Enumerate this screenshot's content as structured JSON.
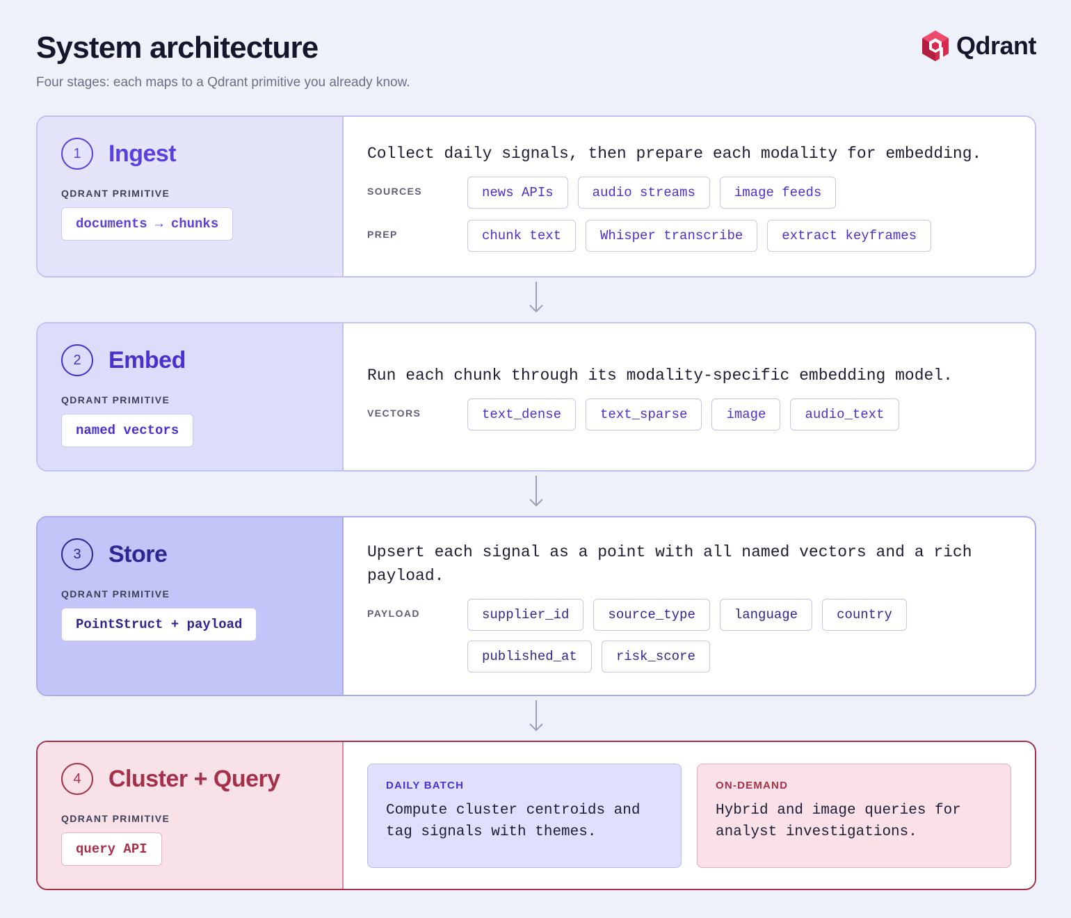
{
  "header": {
    "title": "System architecture",
    "subtitle": "Four stages: each maps to a Qdrant primitive you already know.",
    "logo_text": "Qdrant"
  },
  "colors": {
    "accent": "#5b3fe0",
    "deep_accent": "#2f2696",
    "query_accent": "#a6304a",
    "background": "#eef1fa"
  },
  "stages": [
    {
      "number": "1",
      "title": "Ingest",
      "primitive_label": "QDRANT PRIMITIVE",
      "primitive": "documents → chunks",
      "description": "Collect daily signals, then prepare each modality for embedding.",
      "rows": [
        {
          "label": "SOURCES",
          "chips": [
            "news APIs",
            "audio streams",
            "image feeds"
          ]
        },
        {
          "label": "PREP",
          "chips": [
            "chunk text",
            "Whisper transcribe",
            "extract keyframes"
          ]
        }
      ]
    },
    {
      "number": "2",
      "title": "Embed",
      "primitive_label": "QDRANT PRIMITIVE",
      "primitive": "named vectors",
      "description": "Run each chunk through its modality-specific embedding model.",
      "rows": [
        {
          "label": "VECTORS",
          "chips": [
            "text_dense",
            "text_sparse",
            "image",
            "audio_text"
          ]
        }
      ]
    },
    {
      "number": "3",
      "title": "Store",
      "primitive_label": "QDRANT PRIMITIVE",
      "primitive": "PointStruct + payload",
      "description": "Upsert each signal as a point with all named vectors and a rich payload.",
      "rows": [
        {
          "label": "PAYLOAD",
          "chips": [
            "supplier_id",
            "source_type",
            "language",
            "country",
            "published_at",
            "risk_score"
          ]
        }
      ]
    },
    {
      "number": "4",
      "title": "Cluster + Query",
      "primitive_label": "QDRANT PRIMITIVE",
      "primitive": "query API",
      "cards": [
        {
          "label": "DAILY BATCH",
          "text": "Compute cluster centroids and tag signals with themes."
        },
        {
          "label": "ON-DEMAND",
          "text": "Hybrid and image queries for analyst investigations."
        }
      ]
    }
  ],
  "icons": {
    "logo": "qdrant-cube-icon",
    "connector": "arrow-down-icon"
  }
}
